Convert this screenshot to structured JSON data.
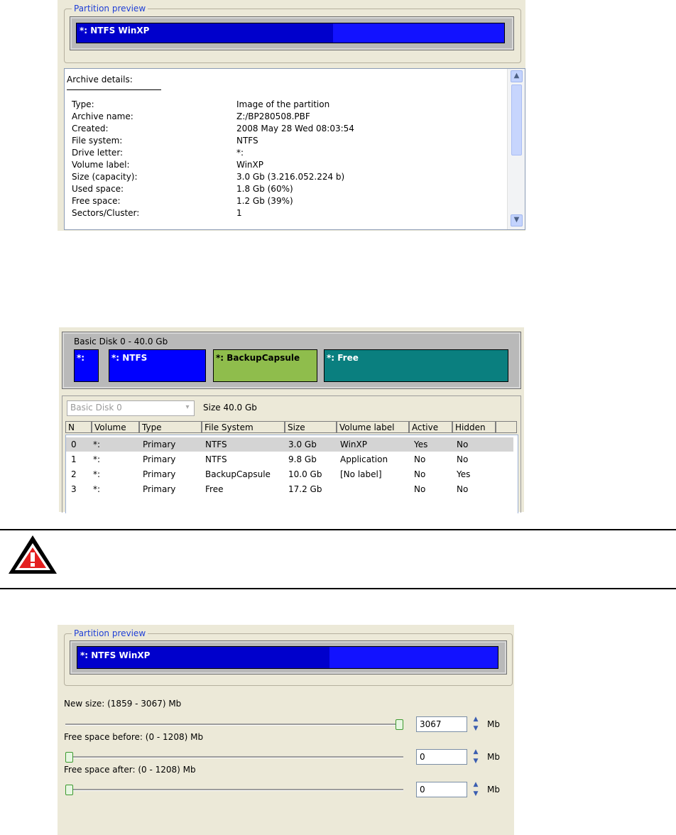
{
  "screen1": {
    "group_title": "Partition preview",
    "partition_label": "*: NTFS WinXP",
    "details_header": "Archive details:",
    "details_divider": "____________________",
    "details": [
      {
        "key": "Type:",
        "value": "Image of the partition"
      },
      {
        "key": "Archive name:",
        "value": "Z:/BP280508.PBF"
      },
      {
        "key": "Created:",
        "value": "2008 May 28 Wed 08:03:54"
      },
      {
        "key": "File system:",
        "value": "NTFS"
      },
      {
        "key": "Drive letter:",
        "value": "*:"
      },
      {
        "key": "Volume label:",
        "value": "WinXP"
      },
      {
        "key": "Size (capacity):",
        "value": "3.0 Gb (3.216.052.224 b)"
      },
      {
        "key": "Used space:",
        "value": "1.8 Gb (60%)"
      },
      {
        "key": "Free space:",
        "value": "1.2 Gb (39%)"
      },
      {
        "key": "Sectors/Cluster:",
        "value": "1"
      }
    ],
    "used_fraction": 0.6,
    "scroll_up_icon": "chevron-up-icon",
    "scroll_down_icon": "chevron-down-icon"
  },
  "screen2": {
    "disk_title": "Basic Disk 0 - 40.0 Gb",
    "map": [
      {
        "label": "*:",
        "color": "#0000ff"
      },
      {
        "label": "*: NTFS",
        "color": "#0000ff"
      },
      {
        "label": "*: BackupCapsule",
        "color": "#8fbd4c"
      },
      {
        "label": "*: Free",
        "color": "#0a7f7f"
      }
    ],
    "disk_select": "Basic Disk 0",
    "size_text": "Size 40.0 Gb",
    "columns": [
      "N",
      "Volume",
      "Type",
      "File System",
      "Size",
      "Volume label",
      "Active",
      "Hidden"
    ],
    "rows": [
      [
        "0",
        "*:",
        "Primary",
        "NTFS",
        "3.0 Gb",
        "WinXP",
        "Yes",
        "No"
      ],
      [
        "1",
        "*:",
        "Primary",
        "NTFS",
        "9.8 Gb",
        "Application",
        "No",
        "No"
      ],
      [
        "2",
        "*:",
        "Primary",
        "BackupCapsule",
        "10.0 Gb",
        "[No label]",
        "No",
        "Yes"
      ],
      [
        "3",
        "*:",
        "Primary",
        "Free",
        "17.2 Gb",
        "",
        "No",
        "No"
      ]
    ],
    "selected_row": 0
  },
  "warning": {
    "icon": "warning-triangle-icon",
    "text": ""
  },
  "screen3": {
    "group_title": "Partition preview",
    "partition_label": "*: NTFS WinXP",
    "used_fraction": 0.6,
    "sliders": [
      {
        "label": "New size: (1859 - 3067) Mb",
        "value": "3067",
        "unit": "Mb",
        "position": 1.0
      },
      {
        "label": "Free space before: (0 - 1208) Mb",
        "value": "0",
        "unit": "Mb",
        "position": 0.0
      },
      {
        "label": "Free space after: (0 - 1208) Mb",
        "value": "0",
        "unit": "Mb",
        "position": 0.0
      }
    ]
  }
}
